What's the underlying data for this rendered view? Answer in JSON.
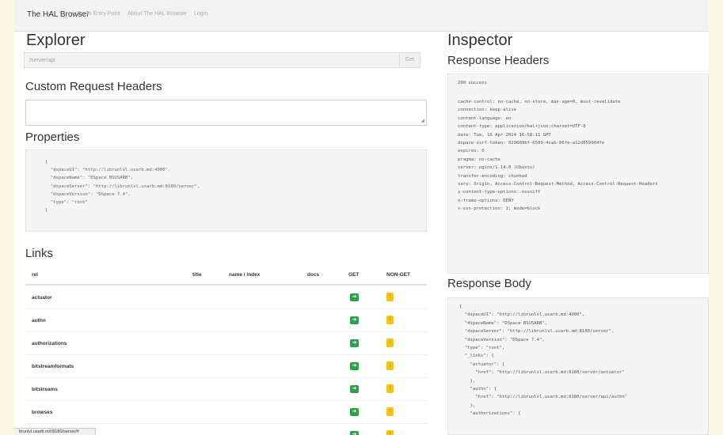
{
  "navbar": {
    "brand": "The HAL Browser",
    "links": [
      "Go To Entry Point",
      "About The HAL Browser",
      "Login"
    ]
  },
  "explorer": {
    "title": "Explorer",
    "url_value": "/server/api",
    "get_label": "Get",
    "custom_headers_title": "Custom Request Headers",
    "properties_title": "Properties",
    "properties_json": "{\n  \"dspaceUI\": \"http://librunlvl.usarb.md:4000\",\n  \"dspaceName\": \"DSpace BSUSARB\",\n  \"dspaceServer\": \"http://librunlvl.usarb.md:8180/server\",\n  \"dspaceVersion\": \"DSpace 7.4\",\n  \"type\": \"root\"\n}"
  },
  "links": {
    "title": "Links",
    "columns": [
      "rel",
      "title",
      "name / index",
      "docs",
      "GET",
      "NON-GET"
    ],
    "rows": [
      "actuator",
      "authn",
      "authorizations",
      "bitstreamformats",
      "bitstreams",
      "browses",
      "",
      ""
    ]
  },
  "inspector": {
    "title": "Inspector",
    "response_headers_title": "Response Headers",
    "status": "200 success",
    "headers": [
      "cache-control: no-cache, no-store, max-age=0, must-revalidate",
      "connection: keep-alive",
      "content-language: en",
      "content-type: application/hal+json;charset=UTF-8",
      "date: Tue, 16 Apr 2024 16:58:11 GMT",
      "dspace-xsrf-token: 029609bf-6509-4cab-86fe-a12d059904fe",
      "expires: 0",
      "pragma: no-cache",
      "server: nginx/1.14.0 (Ubuntu)",
      "transfer-encoding: chunked",
      "vary: Origin, Access-Control-Request-Method, Access-Control-Request-Headers",
      "x-content-type-options: nosniff",
      "x-frame-options: DENY",
      "x-xss-protection: 1; mode=block"
    ],
    "response_body_title": "Response Body",
    "response_body": "{\n  \"dspaceUI\": \"http://librunlvl.usarb.md:4000\",\n  \"dspaceName\": \"DSpace BSUSARB\",\n  \"dspaceServer\": \"http://librunlvl.usarb.md:8180/server\",\n  \"dspaceVersion\": \"DSpace 7.4\",\n  \"type\": \"root\",\n  \"_links\": {\n    \"actuator\": {\n      \"href\": \"http://librunlvl.usarb.md:8180/server/actuator\"\n    },\n    \"authn\": {\n      \"href\": \"http://librunlvl.usarb.md:8180/server/api/authn\"\n    },\n    \"authorizations\": {"
  },
  "statusbar": {
    "url": "brunlvl.usarb.md:8180/server/#"
  },
  "icons": {
    "get": "arrow-right-icon",
    "non_get": "exclamation-icon"
  },
  "colors": {
    "get_button": "#2f9e4f",
    "non_get_button": "#f0c419"
  }
}
